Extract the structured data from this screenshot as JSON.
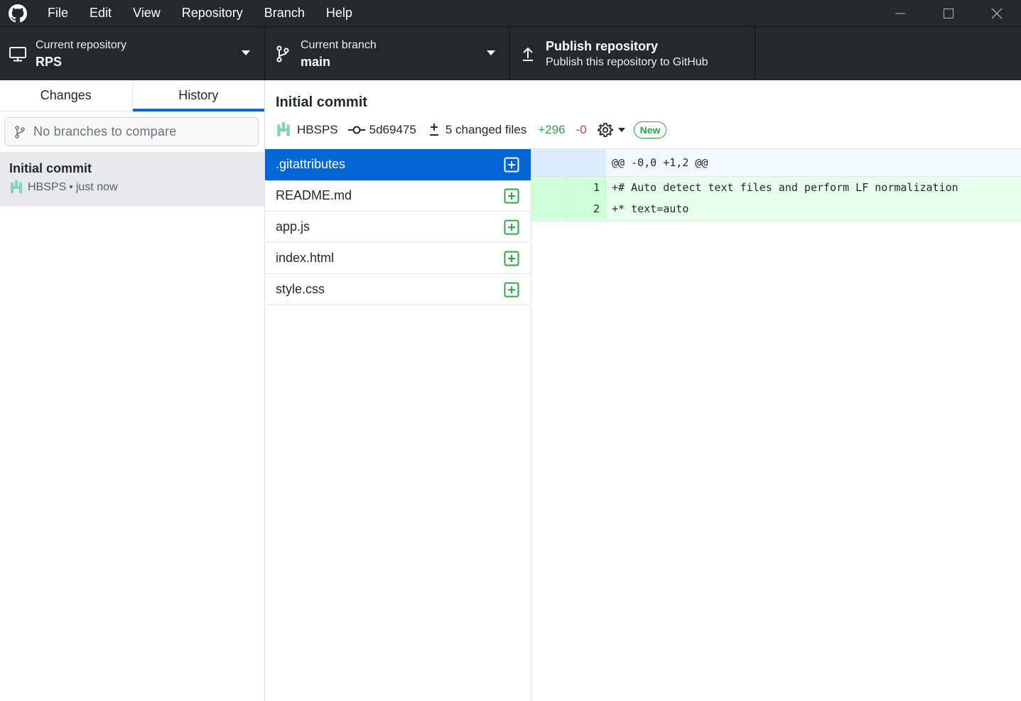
{
  "menu": {
    "items": [
      "File",
      "Edit",
      "View",
      "Repository",
      "Branch",
      "Help"
    ]
  },
  "toolbar": {
    "repo_label": "Current repository",
    "repo_value": "RPS",
    "branch_label": "Current branch",
    "branch_value": "main",
    "publish_title": "Publish repository",
    "publish_sub": "Publish this repository to GitHub"
  },
  "sidebar": {
    "tabs": [
      "Changes",
      "History"
    ],
    "active_tab": "History",
    "compare_placeholder": "No branches to compare",
    "commits": [
      {
        "title": "Initial commit",
        "author": "HBSPS",
        "time": "just now"
      }
    ]
  },
  "commit": {
    "title": "Initial commit",
    "author": "HBSPS",
    "sha": "5d69475",
    "changed_files": "5 changed files",
    "additions": "+296",
    "deletions": "-0",
    "badge": "New"
  },
  "files": [
    {
      "name": ".gitattributes",
      "status": "added",
      "selected": true
    },
    {
      "name": "README.md",
      "status": "added",
      "selected": false
    },
    {
      "name": "app.js",
      "status": "added",
      "selected": false
    },
    {
      "name": "index.html",
      "status": "added",
      "selected": false
    },
    {
      "name": "style.css",
      "status": "added",
      "selected": false
    }
  ],
  "diff": {
    "hunk_header": "@@ -0,0 +1,2 @@",
    "lines": [
      {
        "new": "1",
        "text": "+# Auto detect text files and perform LF normalization"
      },
      {
        "new": "2",
        "text": "+* text=auto"
      }
    ]
  },
  "colors": {
    "titlebar": "#24292e",
    "accent": "#0366d6",
    "addition": "#28a745",
    "deletion": "#d73a49"
  }
}
